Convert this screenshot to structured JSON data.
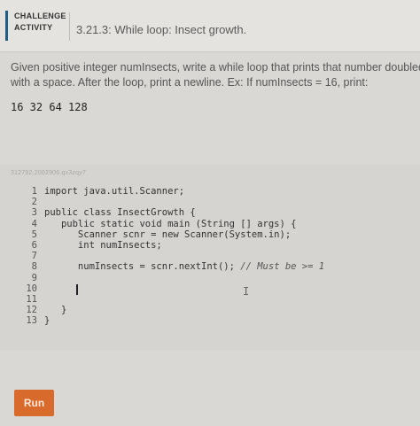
{
  "header": {
    "badge_line1": "CHALLENGE",
    "badge_line2": "ACTIVITY",
    "title": "3.21.3: While loop: Insect growth."
  },
  "prompt": {
    "line1": "Given positive integer numInsects, write a while loop that prints that number doubled",
    "line2": "with a space. After the loop, print a newline. Ex: If numInsects = 16, print:",
    "sample_output": "16 32 64 128"
  },
  "editor": {
    "tag": "312792.2002906.qx3zqy7",
    "lines": [
      {
        "n": "1",
        "code": "import java.util.Scanner;",
        "comment": ""
      },
      {
        "n": "2",
        "code": "",
        "comment": ""
      },
      {
        "n": "3",
        "code": "public class InsectGrowth {",
        "comment": ""
      },
      {
        "n": "4",
        "code": "   public static void main (String [] args) {",
        "comment": ""
      },
      {
        "n": "5",
        "code": "      Scanner scnr = new Scanner(System.in);",
        "comment": ""
      },
      {
        "n": "6",
        "code": "      int numInsects;",
        "comment": ""
      },
      {
        "n": "7",
        "code": "",
        "comment": ""
      },
      {
        "n": "8",
        "code": "      numInsects = scnr.nextInt(); ",
        "comment": "// Must be >= 1"
      },
      {
        "n": "9",
        "code": "",
        "comment": ""
      },
      {
        "n": "10",
        "code": "",
        "comment": ""
      },
      {
        "n": "11",
        "code": "",
        "comment": ""
      },
      {
        "n": "12",
        "code": "   }",
        "comment": ""
      },
      {
        "n": "13",
        "code": "}",
        "comment": ""
      }
    ]
  },
  "run_label": "Run"
}
